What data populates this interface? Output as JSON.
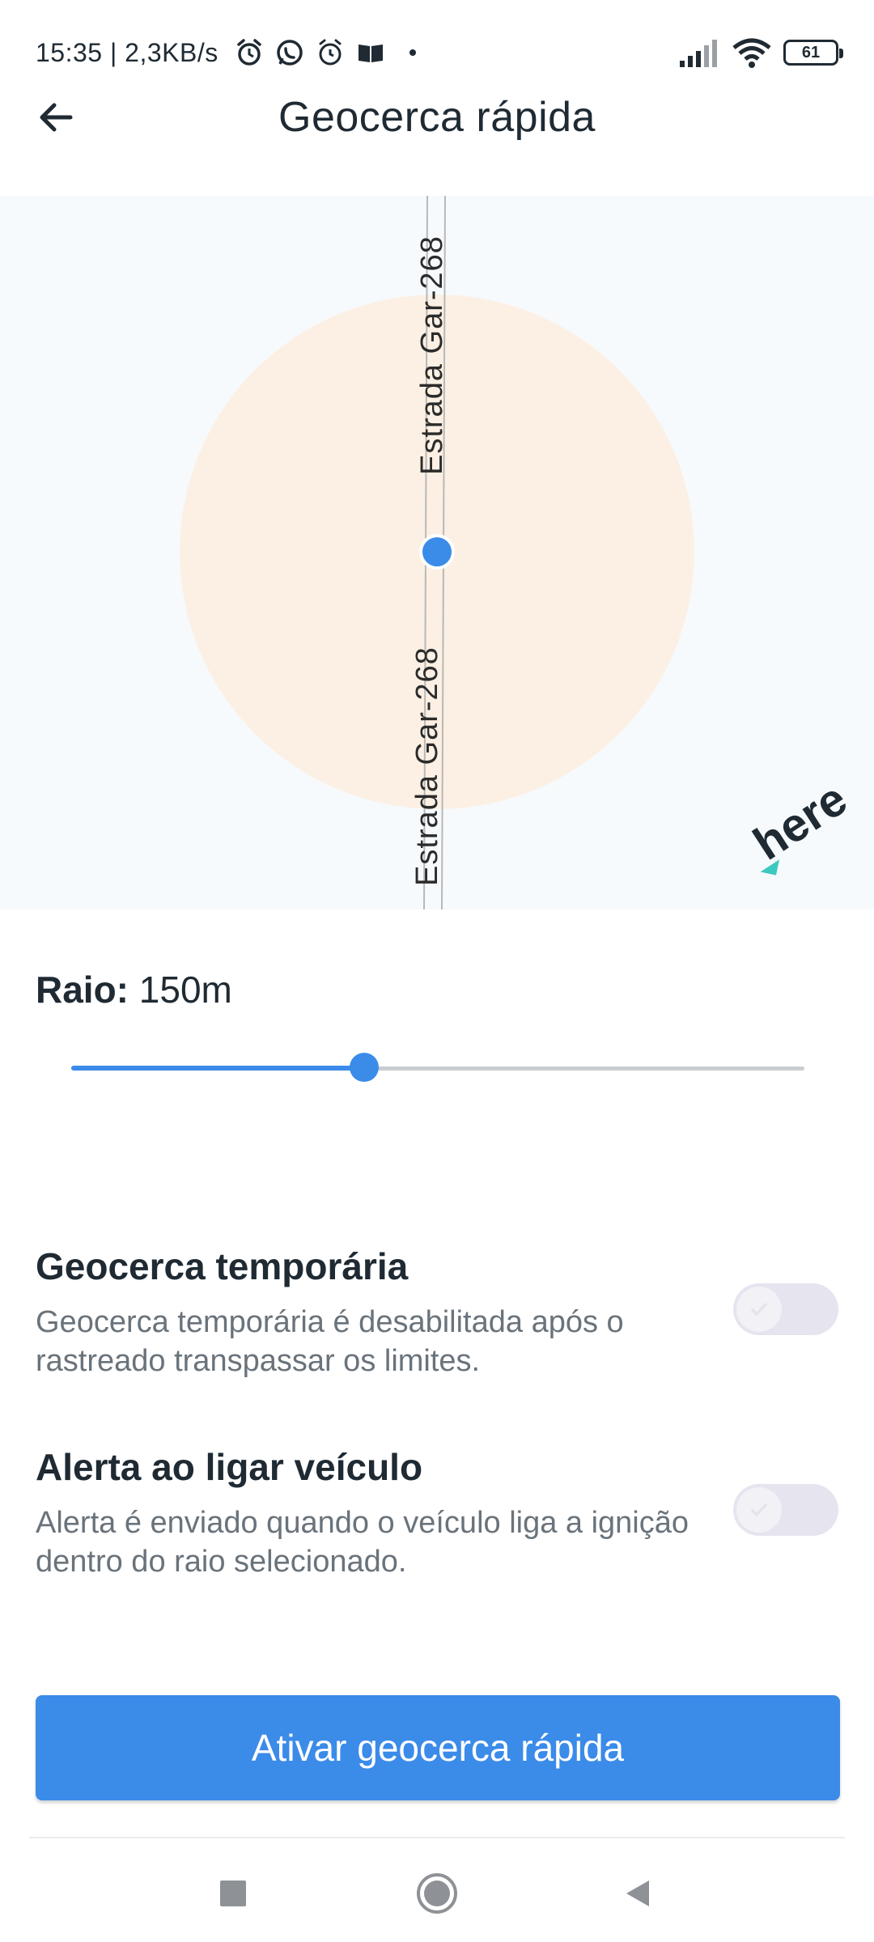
{
  "status_bar": {
    "time_speed": "15:35 | 2,3KB/s",
    "battery": "61",
    "icons": [
      "alarm-icon",
      "whatsapp-icon",
      "alarm-clock-icon",
      "book-icon",
      "signal-icon",
      "wifi-icon",
      "battery-icon"
    ]
  },
  "header": {
    "title": "Geocerca rápida",
    "back_icon": "arrow-left-icon"
  },
  "map": {
    "road_label_top": "Estrada Gar-268",
    "road_label_bottom": "Estrada Gar-268",
    "provider_logo": "here",
    "colors": {
      "background": "#f6fafd",
      "geofence_fill": "#fcf0e4",
      "marker": "#3b8be9"
    }
  },
  "radius": {
    "label": "Raio:",
    "value": "150m",
    "slider_fraction": 0.4
  },
  "options": [
    {
      "title": "Geocerca temporária",
      "description": "Geocerca temporária é desabilitada após o rastreado transpassar os limites.",
      "enabled": false
    },
    {
      "title": "Alerta ao ligar veículo",
      "description": "Alerta é enviado quando o veículo liga a ignição dentro do raio selecionado.",
      "enabled": false
    }
  ],
  "primary_button": {
    "label": "Ativar geocerca rápida",
    "color": "#3b8be9"
  },
  "nav_bar": {
    "icons": [
      "square-recents-icon",
      "circle-home-icon",
      "triangle-back-icon"
    ]
  }
}
